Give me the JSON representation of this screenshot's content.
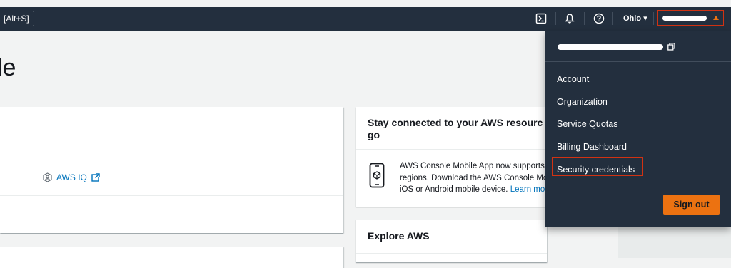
{
  "topbar": {
    "shortcut_hint": "[Alt+S]",
    "region_label": "Ohio ▾",
    "icons": {
      "cloudshell": "cloudshell-icon",
      "notifications": "bell-icon",
      "support": "help-circle-icon",
      "account_caret": "caret-up-icon"
    }
  },
  "page": {
    "title_fragment": "le"
  },
  "left_panel": {
    "link_label": "AWS IQ"
  },
  "stay_connected": {
    "title_line1": "Stay connected to your AWS resourc",
    "title_line2": "go",
    "body_line1": "AWS Console Mobile App now supports",
    "body_line2": "regions. Download the AWS Console Mo",
    "body_line3_text": "iOS or Android mobile device.",
    "learn_more": "Learn mo"
  },
  "explore": {
    "title": "Explore AWS"
  },
  "account_menu": {
    "items": [
      {
        "label": "Account"
      },
      {
        "label": "Organization"
      },
      {
        "label": "Service Quotas"
      },
      {
        "label": "Billing Dashboard"
      },
      {
        "label": "Security credentials"
      }
    ],
    "sign_out_label": "Sign out"
  },
  "colors": {
    "nav_bg": "#232f3e",
    "accent_orange": "#ec7211",
    "highlight_red": "#d13212",
    "link_blue": "#0073bb"
  }
}
